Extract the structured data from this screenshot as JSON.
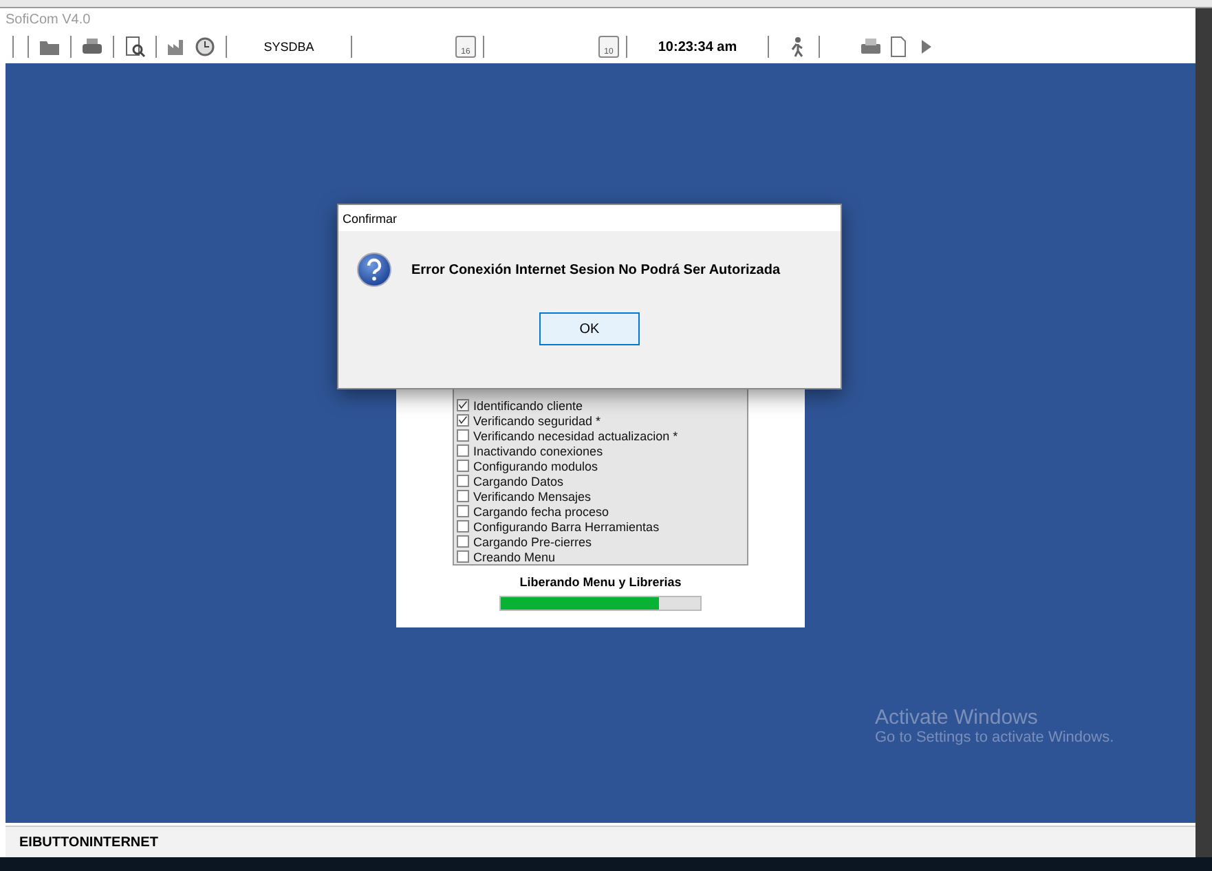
{
  "window": {
    "title": "SofiCom V4.0"
  },
  "toolbar": {
    "user": "SYSDBA",
    "calendars": [
      {
        "day": "16"
      },
      {
        "day": "10"
      }
    ],
    "time": "10:23:34 am"
  },
  "splash": {
    "steps": [
      {
        "label": "Identificando cliente",
        "checked": true
      },
      {
        "label": "Verificando seguridad *",
        "checked": true
      },
      {
        "label": "Verificando necesidad actualizacion *",
        "checked": false
      },
      {
        "label": "Inactivando conexiones",
        "checked": false
      },
      {
        "label": "Configurando modulos",
        "checked": false
      },
      {
        "label": "Cargando Datos",
        "checked": false
      },
      {
        "label": "Verificando Mensajes",
        "checked": false
      },
      {
        "label": "Cargando fecha proceso",
        "checked": false
      },
      {
        "label": "Configurando Barra Herramientas",
        "checked": false
      },
      {
        "label": "Cargando Pre-cierres",
        "checked": false
      },
      {
        "label": "Creando Menu",
        "checked": false
      }
    ],
    "progress_label": "Liberando Menu y Librerias",
    "progress": {
      "level": 0.79
    }
  },
  "dialog": {
    "title": "Confirmar",
    "message": "Error Conexión Internet Sesion No Podrá Ser Autorizada",
    "buttons": [
      "OK"
    ]
  },
  "activation_notice": {
    "title": "Activate Windows",
    "subtitle": "Go to Settings to activate Windows."
  },
  "status_bar": {
    "text": "EIBUTTONINTERNET"
  }
}
